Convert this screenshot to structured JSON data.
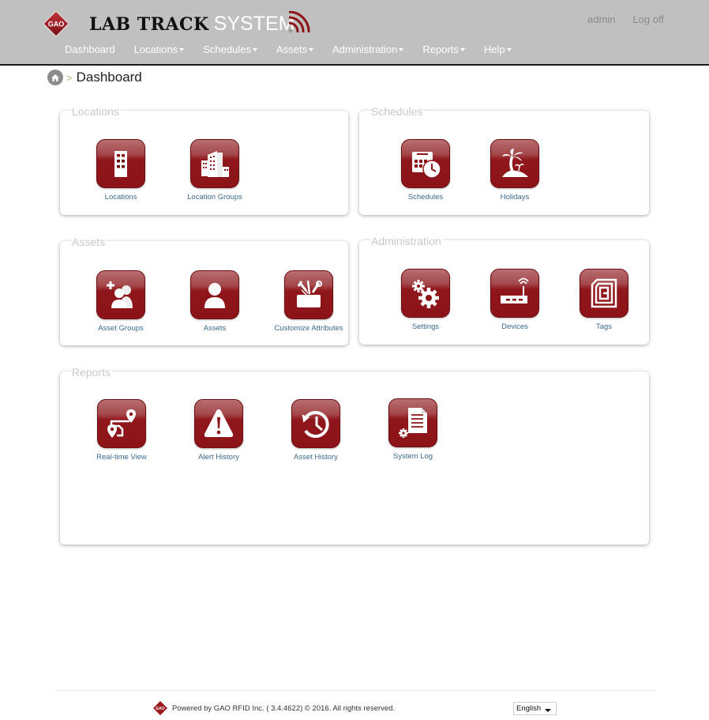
{
  "header": {
    "logo_text": "GAO",
    "brand_bold": "LAB TRACK",
    "brand_light": "SYSTEM",
    "user_links": {
      "username": "admin",
      "logoff": "Log off"
    },
    "nav": [
      {
        "label": "Dashboard",
        "dropdown": false
      },
      {
        "label": "Locations",
        "dropdown": true
      },
      {
        "label": "Schedules",
        "dropdown": true
      },
      {
        "label": "Assets",
        "dropdown": true
      },
      {
        "label": "Administration",
        "dropdown": true
      },
      {
        "label": "Reports",
        "dropdown": true
      },
      {
        "label": "Help",
        "dropdown": true
      }
    ]
  },
  "breadcrumb": {
    "separator": ">",
    "current": "Dashboard"
  },
  "panels": {
    "locations": {
      "title": "Locations",
      "tiles": [
        {
          "label": "Locations",
          "icon": "building-icon"
        },
        {
          "label": "Location Groups",
          "icon": "buildings-group-icon"
        }
      ]
    },
    "schedules": {
      "title": "Schedules",
      "tiles": [
        {
          "label": "Schedules",
          "icon": "calendar-clock-icon"
        },
        {
          "label": "Holidays",
          "icon": "palm-island-icon"
        }
      ]
    },
    "assets": {
      "title": "Assets",
      "tiles": [
        {
          "label": "Asset Groups",
          "icon": "add-users-icon"
        },
        {
          "label": "Assets",
          "icon": "user-icon"
        },
        {
          "label": "Customize Attributes",
          "icon": "toolbox-icon"
        }
      ]
    },
    "administration": {
      "title": "Administration",
      "tiles": [
        {
          "label": "Settings",
          "icon": "gears-icon"
        },
        {
          "label": "Devices",
          "icon": "router-icon"
        },
        {
          "label": "Tags",
          "icon": "rfid-tag-icon"
        }
      ]
    },
    "reports": {
      "title": "Reports",
      "tiles": [
        {
          "label": "Real-time View",
          "icon": "route-map-icon"
        },
        {
          "label": "Alert History",
          "icon": "warning-icon"
        },
        {
          "label": "Asset History",
          "icon": "history-icon"
        },
        {
          "label": "System Log",
          "icon": "document-gear-icon"
        }
      ]
    }
  },
  "footer": {
    "text": "Powered by GAO RFID Inc. ( 3.4.4622) © 2016. All rights reserved.",
    "language": "English"
  },
  "colors": {
    "header_bg": "#c0c0c0",
    "tile_red": "#8c1419",
    "link_blue": "#3a6a8a",
    "panel_title": "#c8c8c8"
  }
}
